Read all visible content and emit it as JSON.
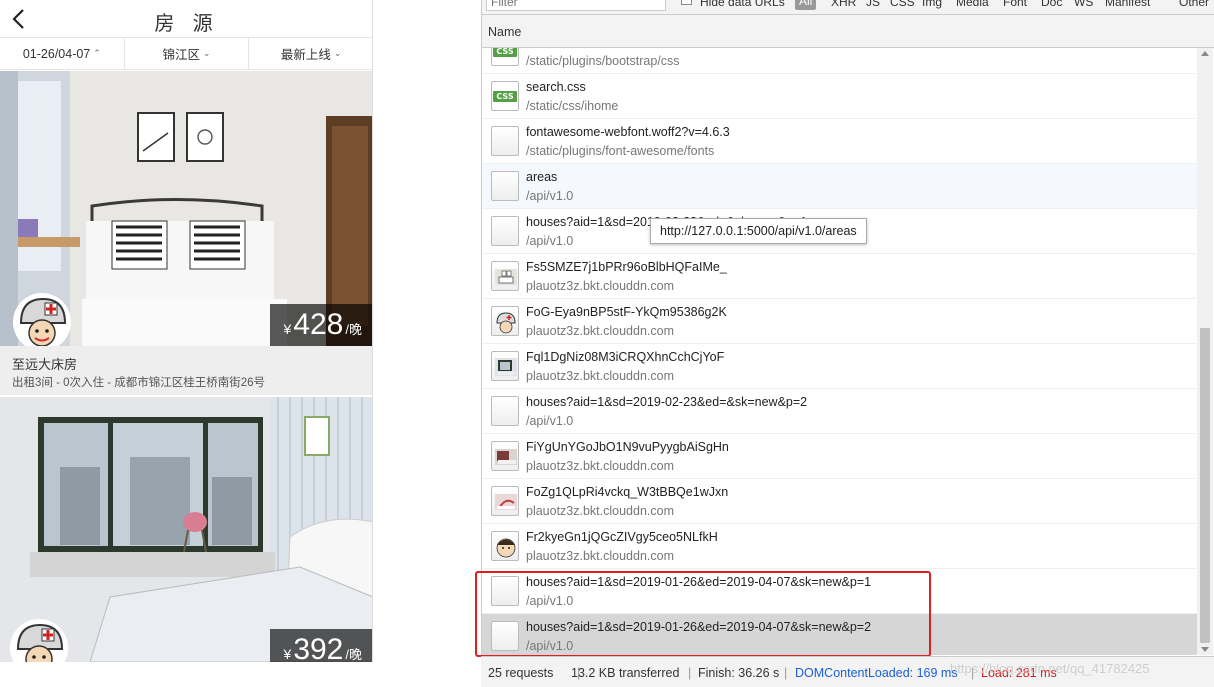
{
  "app": {
    "title": "房 源",
    "back_icon": "chevron-left-icon",
    "filters": [
      {
        "label": "01-26/04-07",
        "caret": "^"
      },
      {
        "label": "锦江区",
        "caret": "v"
      },
      {
        "label": "最新上线",
        "caret": "v"
      }
    ],
    "listings": [
      {
        "price_currency": "¥",
        "price": "428",
        "price_unit": "/晚",
        "title": "至远大床房",
        "subtitle": "出租3间 - 0次入住 - 成都市锦江区桂王桥南街26号",
        "avatar_icon": "helmet-doodle-avatar"
      },
      {
        "price_currency": "¥",
        "price": "392",
        "price_unit": "/晚",
        "avatar_icon": "helmet-doodle-avatar"
      }
    ]
  },
  "devtools": {
    "toolbar": {
      "filter_placeholder": "Filter",
      "hide_data_urls": "Hide data URLs",
      "types": [
        "All",
        "XHR",
        "JS",
        "CSS",
        "Img",
        "Media",
        "Font",
        "Doc",
        "WS",
        "Manifest",
        "Other"
      ]
    },
    "column_header": "Name",
    "requests": [
      {
        "name": "",
        "path": "/static/plugins/bootstrap/css",
        "icon": "css-file-icon"
      },
      {
        "name": "search.css",
        "path": "/static/css/ihome",
        "icon": "css-file-icon"
      },
      {
        "name": "fontawesome-webfont.woff2?v=4.6.3",
        "path": "/static/plugins/font-awesome/fonts",
        "icon": "blank-file-icon"
      },
      {
        "name": "areas",
        "path": "/api/v1.0",
        "icon": "blank-file-icon"
      },
      {
        "name": "houses?aid=1&sd=2019-02-23&ed=&sk=new&p=1",
        "path": "/api/v1.0",
        "icon": "blank-file-icon"
      },
      {
        "name": "Fs5SMZE7j1bPRr96oBlbHQFaIMe_",
        "path": "plauotz3z.bkt.clouddn.com",
        "icon": "image-thumb-icon"
      },
      {
        "name": "FoG-Eya9nBP5stF-YkQm95386g2K",
        "path": "plauotz3z.bkt.clouddn.com",
        "icon": "image-thumb-icon"
      },
      {
        "name": "Fql1DgNiz08M3iCRQXhnCchCjYoF",
        "path": "plauotz3z.bkt.clouddn.com",
        "icon": "image-thumb-icon"
      },
      {
        "name": "houses?aid=1&sd=2019-02-23&ed=&sk=new&p=2",
        "path": "/api/v1.0",
        "icon": "blank-file-icon"
      },
      {
        "name": "FiYgUnYGoJbO1N9vuPyygbAiSgHn",
        "path": "plauotz3z.bkt.clouddn.com",
        "icon": "image-thumb-icon"
      },
      {
        "name": "FoZg1QLpRi4vckq_W3tBBQe1wJxn",
        "path": "plauotz3z.bkt.clouddn.com",
        "icon": "image-thumb-icon"
      },
      {
        "name": "Fr2kyeGn1jQGcZIVgy5ceo5NLfkH",
        "path": "plauotz3z.bkt.clouddn.com",
        "icon": "image-thumb-icon"
      },
      {
        "name": "houses?aid=1&sd=2019-01-26&ed=2019-04-07&sk=new&p=1",
        "path": "/api/v1.0",
        "icon": "blank-file-icon"
      },
      {
        "name": "houses?aid=1&sd=2019-01-26&ed=2019-04-07&sk=new&p=2",
        "path": "/api/v1.0",
        "icon": "blank-file-icon"
      }
    ],
    "tooltip": "http://127.0.0.1:5000/api/v1.0/areas",
    "status": {
      "requests": "25 requests",
      "transferred": "13.2 KB transferred",
      "finish": "Finish: 36.26 s",
      "dom_content_loaded": "DOMContentLoaded: 169 ms",
      "load": "Load: 281 ms"
    },
    "watermark": "https://blog.csdn.net/qq_41782425",
    "colors": {
      "dcl": "#1a5fd6",
      "load": "#d02020",
      "highlight": "#e02020"
    }
  }
}
